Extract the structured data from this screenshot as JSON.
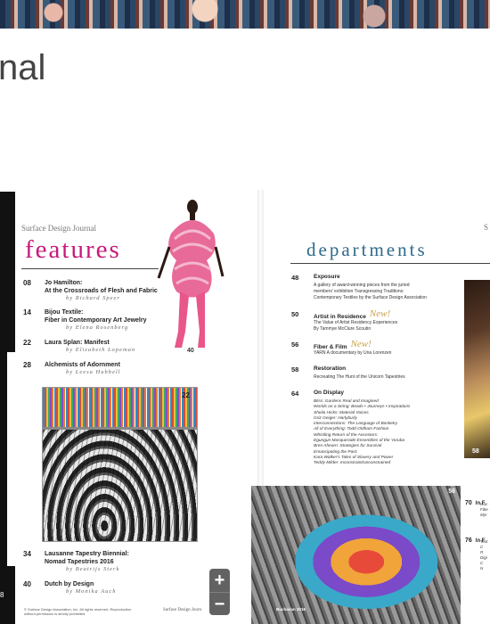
{
  "header": {
    "title": "nal"
  },
  "left_panel": {
    "page_number": "8"
  },
  "left_page": {
    "journal_name": "Surface Design Journal",
    "section_title": "features",
    "figure_page": "40",
    "items": [
      {
        "num": "08",
        "title_line1": "Jo Hamilton:",
        "title_line2": "At the Crossroads of Flesh and Fabric",
        "author": "by Richard Speer"
      },
      {
        "num": "14",
        "title_line1": "Bijou Textile:",
        "title_line2": "Fiber in Contemporary Art Jewelry",
        "author": "by Elena Rosenberg"
      },
      {
        "num": "22",
        "title_line1": "Laura Splan: Manifest",
        "title_line2": "",
        "author": "by Elizabeth Lopeman"
      },
      {
        "num": "28",
        "title_line1": "Alchemists of Adornment",
        "title_line2": "",
        "author": "by Leesa Hubbell"
      },
      {
        "num": "34",
        "title_line1": "Lausanne Tapestry Biennial:",
        "title_line2": "Nomad Tapestries 2016",
        "author": "by Beatrijs Sterk"
      },
      {
        "num": "40",
        "title_line1": "Dutch by Design",
        "title_line2": "",
        "author": "by Monika Auch"
      }
    ],
    "tapestry_page": "22",
    "copyright": "© Surface Design Association, Inc. All rights reserved. Reproduction without permission is strictly prohibited.",
    "footer": "Surface Design Journ"
  },
  "zoom": {
    "in_label": "+",
    "out_label": "−"
  },
  "right_page": {
    "section_title": "departments",
    "edge_letter": "S",
    "items": [
      {
        "num": "48",
        "head": "Exposure",
        "new": "",
        "desc": [
          "A gallery of award-winning pieces from the juried",
          "members' exhibition Transgressing Traditions:",
          "Contemporary Textiles by the Surface Design Association"
        ]
      },
      {
        "num": "50",
        "head": "Artist in Residence",
        "new": "New!",
        "desc": [
          "The Value of Artist Residency Experiences",
          "By Tammye McClure Scoutin"
        ]
      },
      {
        "num": "56",
        "head": "Fiber & Film",
        "new": "New!",
        "desc": [
          "YARN A documentary by Una Lorenzen"
        ]
      },
      {
        "num": "58",
        "head": "Restoration",
        "new": "",
        "desc": [
          "Recreating The Hunt of the Unicorn Tapestries"
        ]
      },
      {
        "num": "64",
        "head": "On Display",
        "new": "",
        "desc": []
      }
    ],
    "on_display": [
      "Bliss: Gardens Real and Imagined",
      "Worlds on a String: Beads • Journeys • Inspirations",
      "Sheila Hicks: Material Voices",
      "Griz Geiger: Harlyburly",
      "Interconnections: The Language of Basketry",
      "All of Everything: Todd Oldham Fashion",
      "Whistling Return of the Ancestors:",
      "   Egungun Masquerade Ensembles of the Yoruba",
      "Bren Ahearn: Strategies for Survival",
      "Emancipating the Past:",
      "   Kara Walker's Tales of Slavery and Power",
      "Teddy Milder: Inconstraint/unconstrained"
    ],
    "portrait_page": "58",
    "umbrella_page": "56",
    "umbrella_caption": "Buchanan 2016",
    "side_entries": [
      {
        "num": "70",
        "head": "In F",
        "lines": [
          "Isoc",
          "Fibe",
          "Myr"
        ]
      },
      {
        "num": "76",
        "head": "In F",
        "lines": [
          "Text",
          "C",
          "R",
          "Digi",
          "C",
          "N"
        ]
      }
    ]
  }
}
